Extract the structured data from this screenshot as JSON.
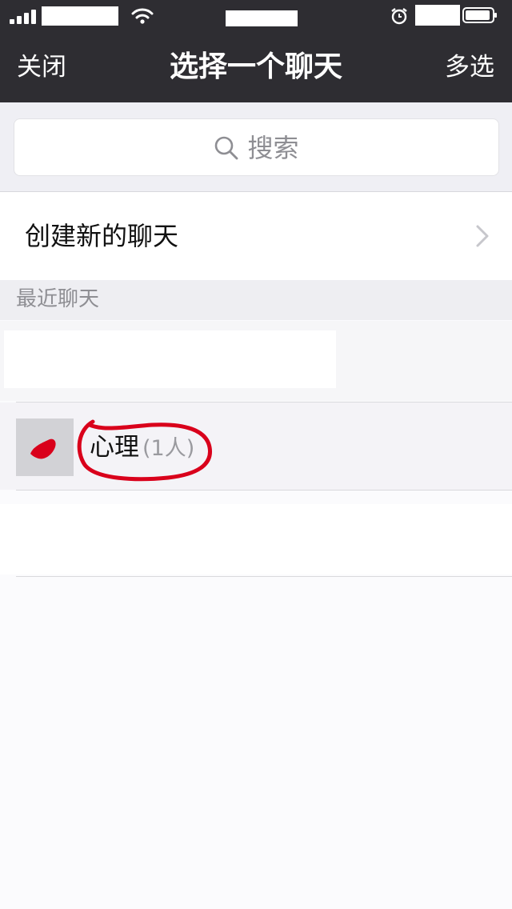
{
  "nav": {
    "close_label": "关闭",
    "title": "选择一个聊天",
    "multi_select_label": "多选"
  },
  "search": {
    "placeholder": "搜索"
  },
  "create_chat": {
    "label": "创建新的聊天"
  },
  "recent": {
    "section_label": "最近聊天",
    "chats": [
      {
        "name": "心理",
        "member_count": "(1人)"
      }
    ]
  },
  "colors": {
    "nav_background": "#2e2d32",
    "annotation": "#d9001b"
  }
}
